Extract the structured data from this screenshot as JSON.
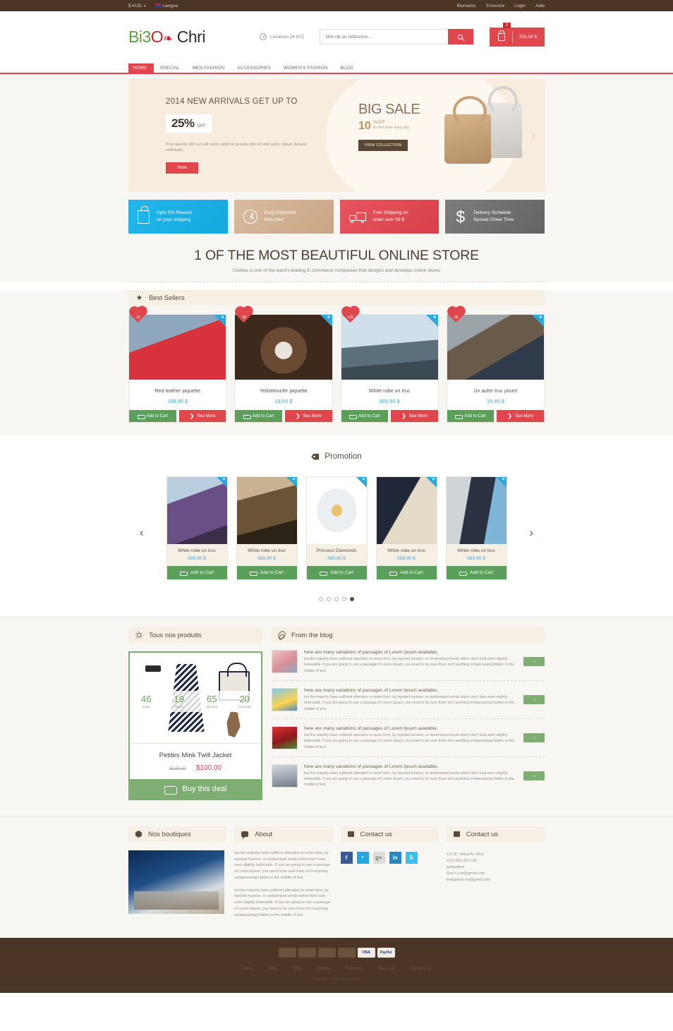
{
  "topbar": {
    "currency": "$ AUD",
    "language": "Langue",
    "links": [
      "Bienvenu",
      "S'inscrire",
      "Login",
      "Aide"
    ]
  },
  "header": {
    "logo_green": "Bi3",
    "logo_red": "O",
    "logo_leaf": "❧",
    "logo_dark": "Chri",
    "shipping_note": "Livraison 24 h/7j",
    "search_placeholder": "Mot clé ou référence ...",
    "cart_count": "2",
    "cart_total": "205,00 $"
  },
  "nav": {
    "items": [
      {
        "label": "HOME",
        "active": true
      },
      {
        "label": "SPECIAL",
        "active": false
      },
      {
        "label": "MEN FASHION",
        "active": false
      },
      {
        "label": "ACCESSORIES",
        "active": false
      },
      {
        "label": "WOMEN'S FASHION",
        "active": false
      },
      {
        "label": "BLOG",
        "active": false
      }
    ]
  },
  "hero": {
    "headline": "2014 NEW ARRIVALS GET UP TO",
    "percent": "25%",
    "off_label": "OFF",
    "paragraph": "Proin gravida nibh vel velit auctor aliqProin gravida nibh vel velit auctor aliquet. Aenean sollicitudin,",
    "more_button": "More",
    "sale_title": "BIG SALE",
    "sale_number": "10",
    "sale_off": "%OFF",
    "sale_sub": "for first order every day",
    "view_collection": "VIEW COLLECTION"
  },
  "features": [
    {
      "icon": "bag-icon",
      "line1": "Upto 5% Reward",
      "line2": "on your shipping",
      "color": "#1aabe0"
    },
    {
      "icon": "clock-icon",
      "line1": "Easy Extended",
      "line2": "Returned",
      "color": "#cca67f"
    },
    {
      "icon": "truck-icon",
      "line1": "Free Shipping on",
      "line2": "order over 99 $",
      "color": "#e0474c"
    },
    {
      "icon": "dollar-icon",
      "line1": "Delivery Schedule",
      "line2": "Spread Cheer Time",
      "color": "#6e6e6e"
    }
  ],
  "headline": {
    "title": "1 OF THE MOST BEAUTIFUL ONLINE STORE",
    "subtitle": "Clothes is one of the word's leading E-commerce companies that designs and develops online stores"
  },
  "best_sellers": {
    "section_title": "Best Sellers",
    "add_to_cart": "Add to Cart",
    "see_more": "See More",
    "products": [
      {
        "name": "Red leather jaquette",
        "price": "189,90 $",
        "badge": "10"
      },
      {
        "name": "Yellotitoucler jaquette",
        "price": "19,00 $",
        "badge": "35"
      },
      {
        "name": "White robe un truc",
        "price": "589,90 $",
        "badge": "125"
      },
      {
        "name": "Un autre truc poure",
        "price": "19,95 $",
        "badge": "05"
      }
    ]
  },
  "promotion": {
    "section_title": "Promotion",
    "add_to_cart": "Add to Cart",
    "products": [
      {
        "name": "White robe un truc",
        "price": "589,90 $"
      },
      {
        "name": "White robe un truc",
        "price": "589,90 $"
      },
      {
        "name": "Princess Diamonds",
        "price": "589,90 $"
      },
      {
        "name": "White robe un truc",
        "price": "589,90 $"
      },
      {
        "name": "White robe un truc",
        "price": "589,90 $"
      }
    ],
    "dots": [
      false,
      false,
      false,
      false,
      true
    ],
    "prev": "‹",
    "next": "›"
  },
  "deal": {
    "panel_title": "Tous nos produits",
    "countdown": [
      {
        "value": "46",
        "label": "Days"
      },
      {
        "value": "19",
        "label": "Hours"
      },
      {
        "value": "65",
        "label": "Minutes"
      },
      {
        "value": "20",
        "label": "Seconds"
      }
    ],
    "product_name": "Petites Mink Twill Jacket",
    "old_price": "$120.00",
    "new_price": "$100.00",
    "buy_button": "Buy this deal"
  },
  "blog": {
    "panel_title": "From the blog",
    "arrow": "→",
    "posts": [
      {
        "title": "here are many variations of passages of Lorem Ipsum available,",
        "body": "but the majority have suffered alteration in some form, by injected humour, or randomised words which don't look even slightly believable. If you are going to use a passage of Lorem Ipsum, you need to be sure there isn't anything embarrassing hidden in the middle of text."
      },
      {
        "title": "here are many variations of passages of Lorem Ipsum available,",
        "body": "but the majority have suffered alteration in some form, by injected humour, or randomised words which don't look even slightly believable. If you are going to use a passage of Lorem Ipsum, you need to be sure there isn't anything embarrassing hidden in the middle of text."
      },
      {
        "title": "here are many variations of passages of Lorem Ipsum available,",
        "body": "but the majority have suffered alteration in some form, by injected humour, or randomised words which don't look even slightly believable. If you are going to use a passage of Lorem Ipsum, you need to be sure there isn't anything embarrassing hidden in the middle of text."
      },
      {
        "title": "here are many variations of passages of Lorem Ipsum available,",
        "body": "but the majority have suffered alteration in some form, by injected humour, or randomised words which don't look even slightly believable. If you are going to use a passage of Lorem Ipsum, you need to be sure there isn't anything embarrassing hidden in the middle of text."
      }
    ]
  },
  "footer": {
    "boutiques_title": "Nos boutiques",
    "about_title": "About",
    "contact_title": "Contact us",
    "contact2_title": "Contact us",
    "about_p1": "but the majority have suffered alteration in some form, by injected humour, or randomised words which don't look even slightly believable. If you are going to use a passage of Lorem Ipsum, you need to be sure there isn't anything embarrassing hidden in the middle of text.",
    "about_p2": "but the majority have suffered alteration in some form, by injected humour, or randomised words which don't look even slightly believable. If you are going to use a passage of Lorem Ipsum, you need to be sure there isn't anything embarrassing hidden in the middle of text.",
    "socials": [
      {
        "name": "facebook-icon",
        "glyph": "f"
      },
      {
        "name": "twitter-icon",
        "glyph": "ᵛ"
      },
      {
        "name": "googleplus-icon",
        "glyph": "g+"
      },
      {
        "name": "linkedin-icon",
        "glyph": "in"
      },
      {
        "name": "skype-icon",
        "glyph": "S"
      }
    ],
    "address_lines": [
      "123 St, Yellow Av, Mroc",
      "+212-601-201-194",
      "qsdqsdqsd",
      "Goh.h.com@gmail.com",
      "Bridgetech.ma@gmail.com"
    ]
  },
  "bottombar": {
    "payments": [
      "MasterCard",
      "Maestro",
      "VISA Electron",
      "Discover",
      "VISA",
      "PayPal"
    ],
    "links": [
      "Home",
      "Blog",
      "Shop",
      "Media",
      "Features",
      "About Us",
      "Contact Us"
    ],
    "copyright": "Copyright © 2014 Bridgetech"
  }
}
